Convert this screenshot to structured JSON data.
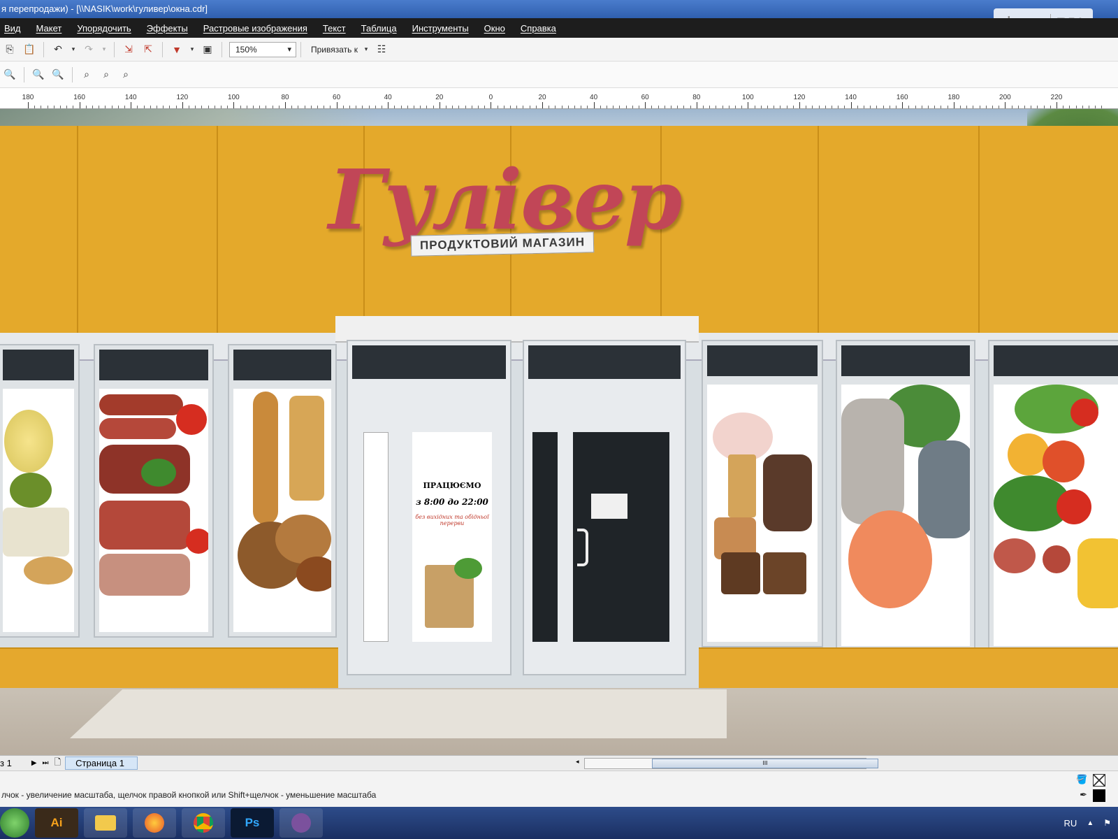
{
  "window": {
    "title": "я перепродажи) - [\\\\NASIK\\work\\гуливер\\окна.cdr]",
    "watermark_left": "dom",
    "watermark_right": "RIA"
  },
  "menu": {
    "items": [
      "Вид",
      "Макет",
      "Упорядочить",
      "Эффекты",
      "Растровые изображения",
      "Текст",
      "Таблица",
      "Инструменты",
      "Окно",
      "Справка"
    ]
  },
  "toolbar": {
    "zoom_value": "150%",
    "snap_label": "Привязать к"
  },
  "ruler": {
    "labels": [
      "180",
      "160",
      "140",
      "120",
      "100",
      "80",
      "60",
      "40",
      "20",
      "0",
      "20",
      "40",
      "60",
      "80",
      "100",
      "120",
      "140",
      "160",
      "180",
      "200",
      "220"
    ]
  },
  "storefront": {
    "brand": "Гулівер",
    "subtitle": "ПРОДУКТОВИЙ МАГАЗИН",
    "door_poster": {
      "line1": "ПРАЦЮЄМО",
      "line2": "з 8:00 до 22:00",
      "line3": "без вихідних та обідньої перерви"
    }
  },
  "pagebar": {
    "page_counter": "з 1",
    "page_tab": "Страница 1",
    "scroll_grip": "III"
  },
  "status": {
    "message": "лчок - увеличение масштаба, щелчок правой кнопкой или Shift+щелчок - уменьшение масштаба"
  },
  "taskbar": {
    "apps": [
      "Ai",
      "",
      "",
      "",
      "Ps",
      ""
    ],
    "language": "RU"
  },
  "colors": {
    "facade": "#e4a92b",
    "sign": "#c14657",
    "menubar": "#1d1d1d",
    "taskbar": "#1b2f62"
  }
}
